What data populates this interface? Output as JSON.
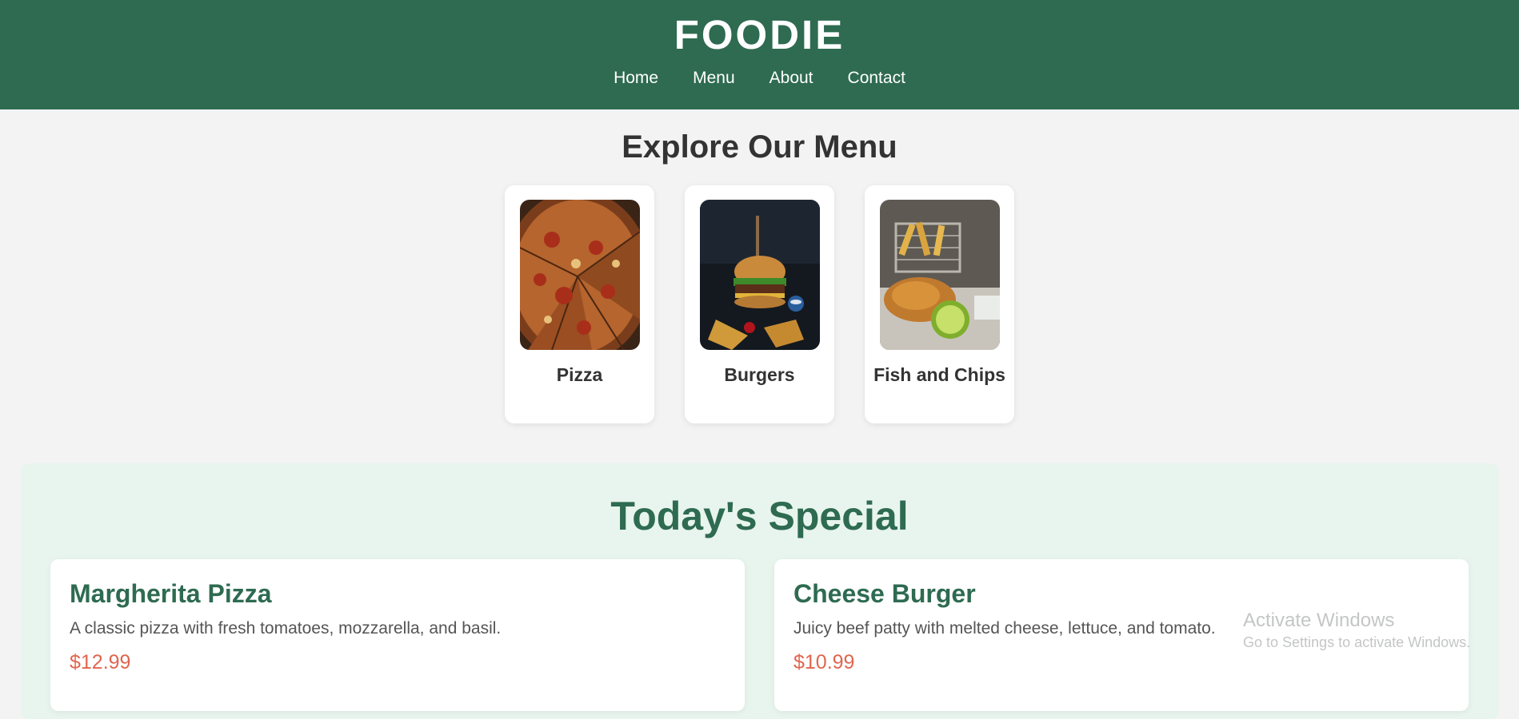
{
  "header": {
    "brand": "FOODIE",
    "nav": [
      "Home",
      "Menu",
      "About",
      "Contact"
    ]
  },
  "menu": {
    "title": "Explore Our Menu",
    "categories": [
      "Pizza",
      "Burgers",
      "Fish and Chips"
    ]
  },
  "special": {
    "title": "Today's Special",
    "items": [
      {
        "name": "Margherita Pizza",
        "description": "A classic pizza with fresh tomatoes, mozzarella, and basil.",
        "price": "$12.99"
      },
      {
        "name": "Cheese Burger",
        "description": "Juicy beef patty with melted cheese, lettuce, and tomato.",
        "price": "$10.99"
      }
    ]
  },
  "watermark": {
    "line1": "Activate Windows",
    "line2": "Go to Settings to activate Windows."
  },
  "colors": {
    "brand_green": "#2e6b51",
    "price_red": "#e0664f",
    "special_bg": "#e8f4ee",
    "page_bg": "#f3f3f3"
  }
}
